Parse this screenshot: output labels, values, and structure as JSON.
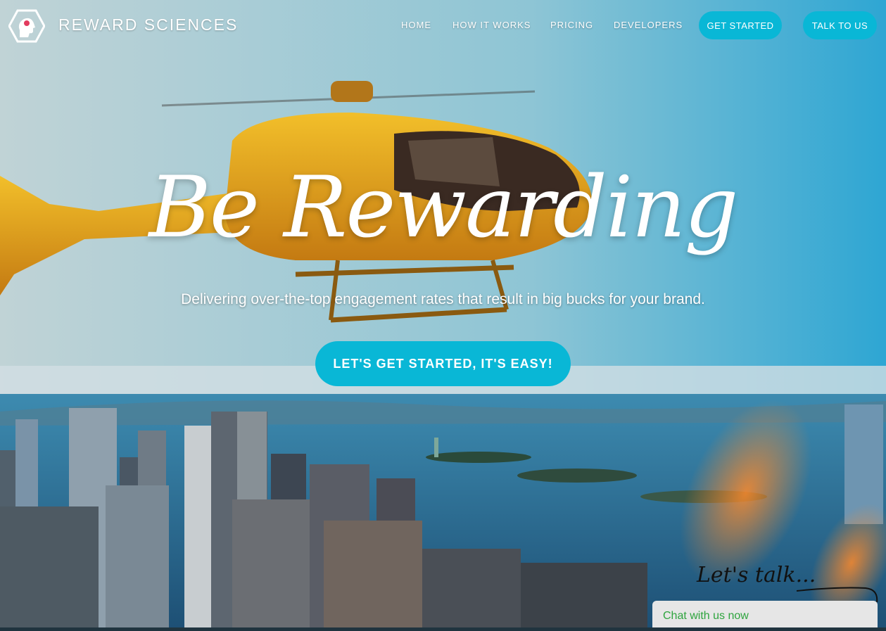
{
  "brand": {
    "name": "REWARD SCIENCES"
  },
  "nav": {
    "links": [
      "HOME",
      "HOW IT WORKS",
      "PRICING",
      "DEVELOPERS"
    ],
    "get_started": "GET STARTED",
    "talk_to_us": "TALK TO US"
  },
  "hero": {
    "headline": "Be Rewarding",
    "subline": "Delivering over-the-top engagement rates that result in big bucks for your brand.",
    "cta": "LET'S GET STARTED, IT'S EASY!"
  },
  "chat": {
    "handwriting": "Let's talk...",
    "label": "Chat with us now"
  },
  "colors": {
    "accent": "#09b7d6",
    "chat_text": "#2ea43e",
    "helicopter": "#e3a51a"
  },
  "icons": {
    "logo": "head-hexagon-icon"
  }
}
